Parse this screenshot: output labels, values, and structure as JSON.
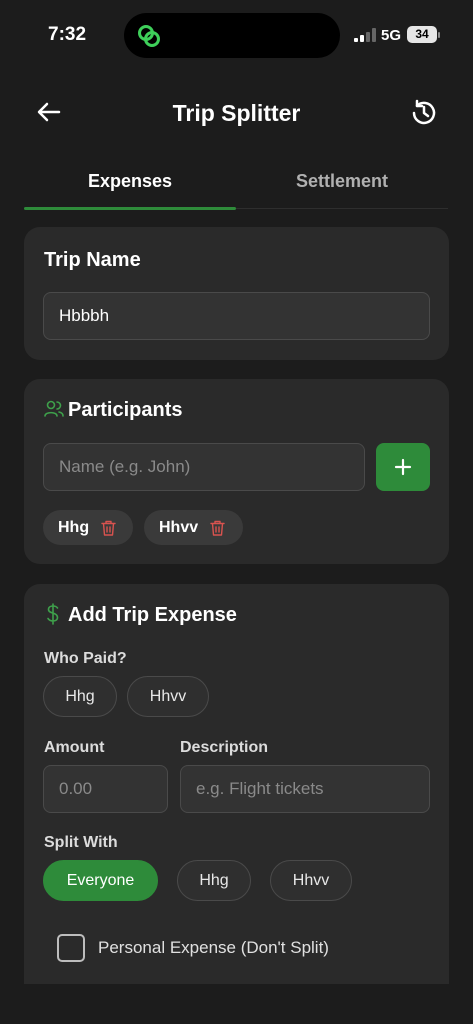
{
  "status": {
    "time": "7:32",
    "network": "5G",
    "battery": "34"
  },
  "header": {
    "title": "Trip Splitter",
    "back_icon": "arrow-left-icon",
    "history_icon": "history-icon"
  },
  "tabs": [
    {
      "label": "Expenses",
      "active": true
    },
    {
      "label": "Settlement",
      "active": false
    }
  ],
  "trip_name": {
    "title": "Trip Name",
    "value": "Hbbbh"
  },
  "participants": {
    "title": "Participants",
    "input_placeholder": "Name (e.g. John)",
    "people": [
      {
        "name": "Hhg"
      },
      {
        "name": "Hhvv"
      }
    ]
  },
  "add_expense": {
    "title": "Add Trip Expense",
    "who_paid_label": "Who Paid?",
    "payers": [
      "Hhg",
      "Hhvv"
    ],
    "amount_label": "Amount",
    "amount_placeholder": "0.00",
    "description_label": "Description",
    "description_placeholder": "e.g. Flight tickets",
    "split_with_label": "Split With",
    "split_options": [
      "Everyone",
      "Hhg",
      "Hhvv"
    ],
    "split_selected": "Everyone",
    "personal_label": "Personal Expense (Don't Split)",
    "personal_checked": false
  },
  "colors": {
    "accent": "#2e8b3a",
    "background": "#1c1c1c",
    "card": "#2a2a2a",
    "danger": "#d9534f"
  }
}
